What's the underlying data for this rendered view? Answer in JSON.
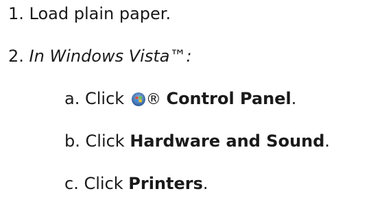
{
  "steps": [
    {
      "number": "1.",
      "text": "Load plain paper."
    },
    {
      "number": "2.",
      "text": "In Windows Vista™:"
    }
  ],
  "substeps": [
    {
      "letter": "a.",
      "prefix": "Click",
      "icon": "windows-start-orb-icon",
      "mark": "®",
      "bold": "Control Panel",
      "suffix": "."
    },
    {
      "letter": "b.",
      "prefix": "Click",
      "bold": "Hardware and Sound",
      "suffix": "."
    },
    {
      "letter": "c.",
      "prefix": "Click",
      "bold": "Printers",
      "suffix": "."
    }
  ]
}
